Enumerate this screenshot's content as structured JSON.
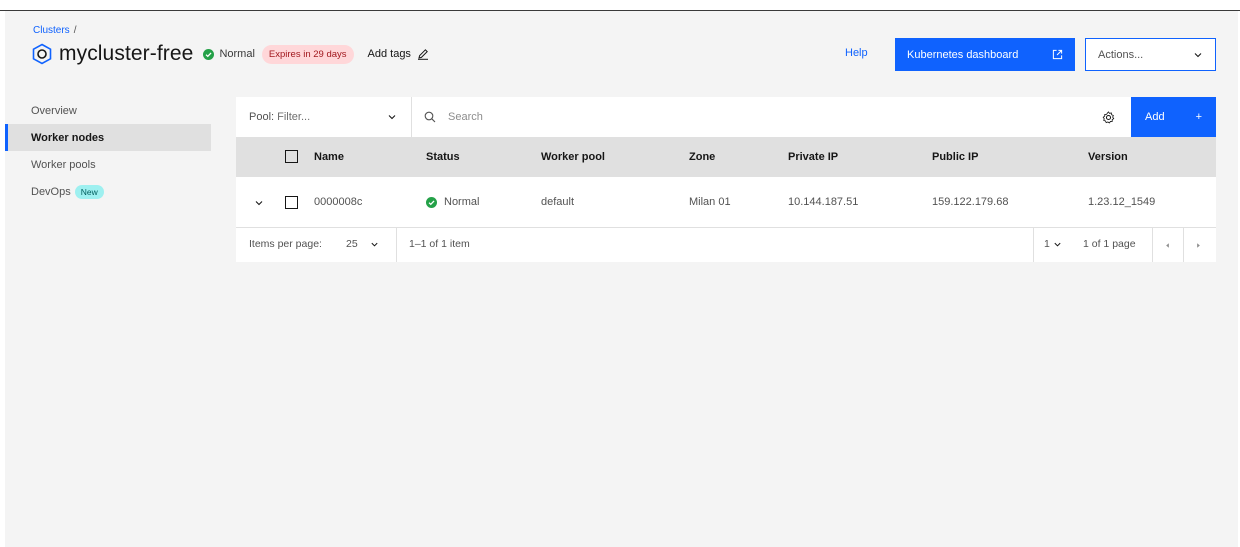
{
  "breadcrumb": {
    "root": "Clusters",
    "separator": "/"
  },
  "cluster": {
    "name": "mycluster-free",
    "status": "Normal",
    "expires": "Expires in 29 days",
    "add_tags": "Add tags"
  },
  "header": {
    "help": "Help",
    "dashboard_button": "Kubernetes dashboard",
    "actions_placeholder": "Actions..."
  },
  "sidebar": {
    "items": [
      {
        "label": "Overview"
      },
      {
        "label": "Worker nodes",
        "active": true
      },
      {
        "label": "Worker pools"
      },
      {
        "label": "DevOps",
        "tag": "New"
      }
    ]
  },
  "toolbar": {
    "pool_label": "Pool:",
    "pool_placeholder": "Filter...",
    "search_placeholder": "Search",
    "add_label": "Add",
    "add_symbol": "+"
  },
  "table": {
    "columns": [
      "Name",
      "Status",
      "Worker pool",
      "Zone",
      "Private IP",
      "Public IP",
      "Version"
    ],
    "rows": [
      {
        "name": "0000008c",
        "status": "Normal",
        "worker_pool": "default",
        "zone": "Milan 01",
        "private_ip": "10.144.187.51",
        "public_ip": "159.122.179.68",
        "version": "1.23.12_1549"
      }
    ]
  },
  "pagination": {
    "items_per_page_label": "Items per page:",
    "items_per_page_value": "25",
    "range": "1–1 of 1 item",
    "page_value": "1",
    "page_total": "1 of 1 page"
  },
  "colors": {
    "primary": "#0f62fe",
    "success": "#24a148",
    "expires_bg": "#ffd7d9",
    "new_tag_bg": "#9ef0f0"
  }
}
